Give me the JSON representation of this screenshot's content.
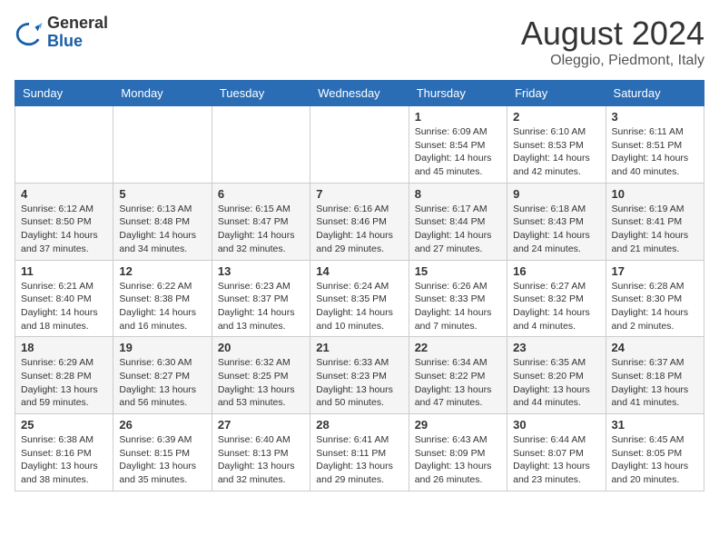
{
  "logo": {
    "general": "General",
    "blue": "Blue"
  },
  "header": {
    "month": "August 2024",
    "location": "Oleggio, Piedmont, Italy"
  },
  "weekdays": [
    "Sunday",
    "Monday",
    "Tuesday",
    "Wednesday",
    "Thursday",
    "Friday",
    "Saturday"
  ],
  "weeks": [
    [
      null,
      null,
      null,
      null,
      {
        "day": 1,
        "sunrise": "6:09 AM",
        "sunset": "8:54 PM",
        "daylight": "14 hours and 45 minutes."
      },
      {
        "day": 2,
        "sunrise": "6:10 AM",
        "sunset": "8:53 PM",
        "daylight": "14 hours and 42 minutes."
      },
      {
        "day": 3,
        "sunrise": "6:11 AM",
        "sunset": "8:51 PM",
        "daylight": "14 hours and 40 minutes."
      }
    ],
    [
      {
        "day": 4,
        "sunrise": "6:12 AM",
        "sunset": "8:50 PM",
        "daylight": "14 hours and 37 minutes."
      },
      {
        "day": 5,
        "sunrise": "6:13 AM",
        "sunset": "8:48 PM",
        "daylight": "14 hours and 34 minutes."
      },
      {
        "day": 6,
        "sunrise": "6:15 AM",
        "sunset": "8:47 PM",
        "daylight": "14 hours and 32 minutes."
      },
      {
        "day": 7,
        "sunrise": "6:16 AM",
        "sunset": "8:46 PM",
        "daylight": "14 hours and 29 minutes."
      },
      {
        "day": 8,
        "sunrise": "6:17 AM",
        "sunset": "8:44 PM",
        "daylight": "14 hours and 27 minutes."
      },
      {
        "day": 9,
        "sunrise": "6:18 AM",
        "sunset": "8:43 PM",
        "daylight": "14 hours and 24 minutes."
      },
      {
        "day": 10,
        "sunrise": "6:19 AM",
        "sunset": "8:41 PM",
        "daylight": "14 hours and 21 minutes."
      }
    ],
    [
      {
        "day": 11,
        "sunrise": "6:21 AM",
        "sunset": "8:40 PM",
        "daylight": "14 hours and 18 minutes."
      },
      {
        "day": 12,
        "sunrise": "6:22 AM",
        "sunset": "8:38 PM",
        "daylight": "14 hours and 16 minutes."
      },
      {
        "day": 13,
        "sunrise": "6:23 AM",
        "sunset": "8:37 PM",
        "daylight": "14 hours and 13 minutes."
      },
      {
        "day": 14,
        "sunrise": "6:24 AM",
        "sunset": "8:35 PM",
        "daylight": "14 hours and 10 minutes."
      },
      {
        "day": 15,
        "sunrise": "6:26 AM",
        "sunset": "8:33 PM",
        "daylight": "14 hours and 7 minutes."
      },
      {
        "day": 16,
        "sunrise": "6:27 AM",
        "sunset": "8:32 PM",
        "daylight": "14 hours and 4 minutes."
      },
      {
        "day": 17,
        "sunrise": "6:28 AM",
        "sunset": "8:30 PM",
        "daylight": "14 hours and 2 minutes."
      }
    ],
    [
      {
        "day": 18,
        "sunrise": "6:29 AM",
        "sunset": "8:28 PM",
        "daylight": "13 hours and 59 minutes."
      },
      {
        "day": 19,
        "sunrise": "6:30 AM",
        "sunset": "8:27 PM",
        "daylight": "13 hours and 56 minutes."
      },
      {
        "day": 20,
        "sunrise": "6:32 AM",
        "sunset": "8:25 PM",
        "daylight": "13 hours and 53 minutes."
      },
      {
        "day": 21,
        "sunrise": "6:33 AM",
        "sunset": "8:23 PM",
        "daylight": "13 hours and 50 minutes."
      },
      {
        "day": 22,
        "sunrise": "6:34 AM",
        "sunset": "8:22 PM",
        "daylight": "13 hours and 47 minutes."
      },
      {
        "day": 23,
        "sunrise": "6:35 AM",
        "sunset": "8:20 PM",
        "daylight": "13 hours and 44 minutes."
      },
      {
        "day": 24,
        "sunrise": "6:37 AM",
        "sunset": "8:18 PM",
        "daylight": "13 hours and 41 minutes."
      }
    ],
    [
      {
        "day": 25,
        "sunrise": "6:38 AM",
        "sunset": "8:16 PM",
        "daylight": "13 hours and 38 minutes."
      },
      {
        "day": 26,
        "sunrise": "6:39 AM",
        "sunset": "8:15 PM",
        "daylight": "13 hours and 35 minutes."
      },
      {
        "day": 27,
        "sunrise": "6:40 AM",
        "sunset": "8:13 PM",
        "daylight": "13 hours and 32 minutes."
      },
      {
        "day": 28,
        "sunrise": "6:41 AM",
        "sunset": "8:11 PM",
        "daylight": "13 hours and 29 minutes."
      },
      {
        "day": 29,
        "sunrise": "6:43 AM",
        "sunset": "8:09 PM",
        "daylight": "13 hours and 26 minutes."
      },
      {
        "day": 30,
        "sunrise": "6:44 AM",
        "sunset": "8:07 PM",
        "daylight": "13 hours and 23 minutes."
      },
      {
        "day": 31,
        "sunrise": "6:45 AM",
        "sunset": "8:05 PM",
        "daylight": "13 hours and 20 minutes."
      }
    ]
  ]
}
